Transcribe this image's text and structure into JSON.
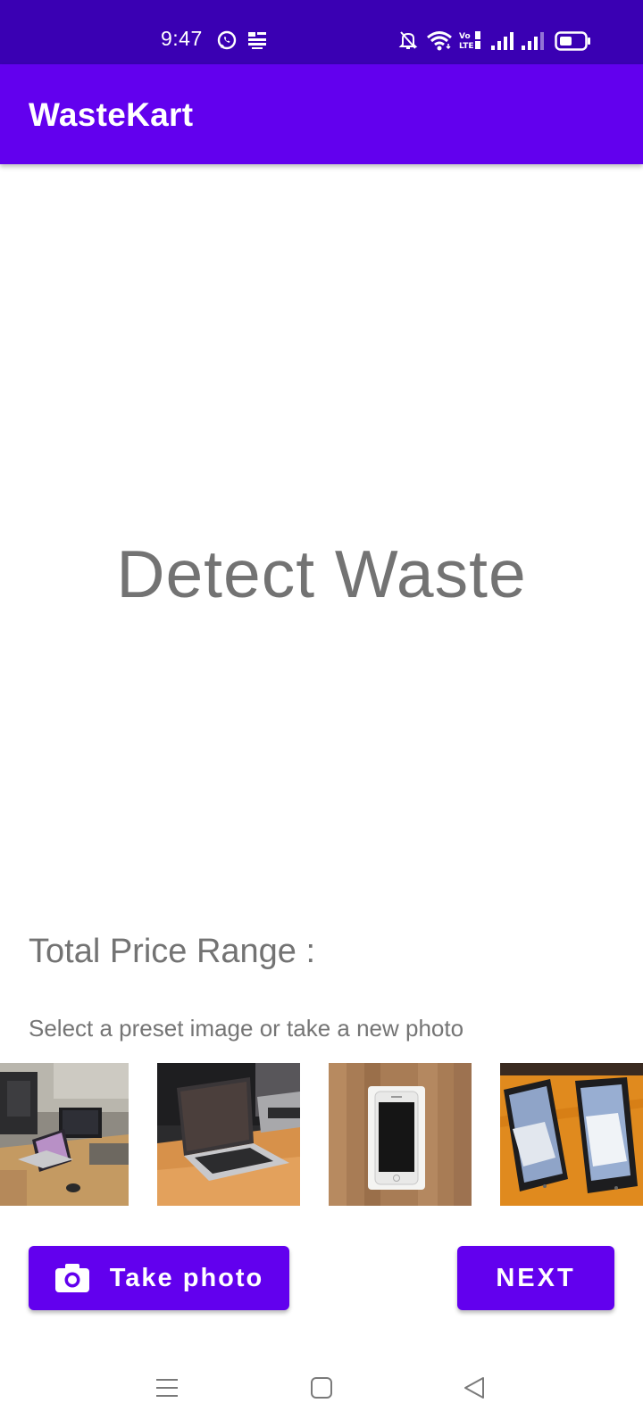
{
  "status_bar": {
    "time": "9:47",
    "icons": [
      "whatsapp-icon",
      "news-app-icon",
      "mute-icon",
      "wifi-icon",
      "volte-icon",
      "signal-icon",
      "signal-icon-2",
      "battery-icon"
    ],
    "background": "#3A00B3"
  },
  "app_bar": {
    "title": "WasteKart",
    "background": "#6200EE"
  },
  "main": {
    "result_text": "Detect Waste",
    "price_label": "Total Price Range :",
    "instruction": "Select a preset image or take a new photo"
  },
  "presets": [
    {
      "name": "desk-computers-photo"
    },
    {
      "name": "laptop-on-table-photo"
    },
    {
      "name": "smartphone-in-box-photo"
    },
    {
      "name": "two-phones-photo"
    }
  ],
  "buttons": {
    "take_photo": "Take photo",
    "take_photo_icon": "camera-icon",
    "next": "NEXT",
    "color": "#6200EE"
  },
  "nav": {
    "icons": [
      "menu-icon",
      "home-icon",
      "back-icon"
    ]
  }
}
